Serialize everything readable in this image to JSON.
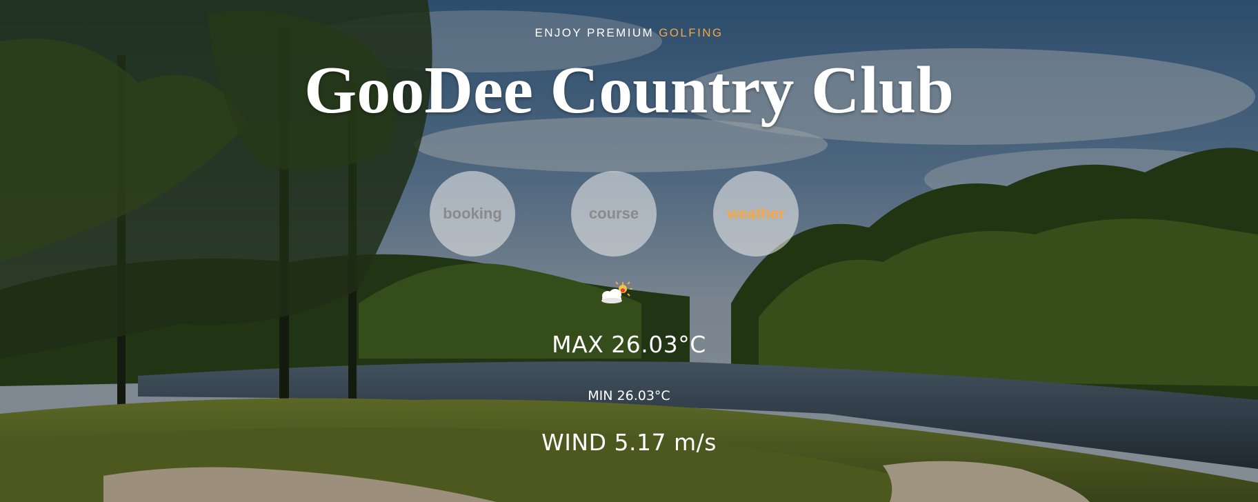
{
  "hero": {
    "tagline_prefix": "ENJOY PREMIUM",
    "tagline_accent": "GOLFING",
    "title": "GooDee Country Club"
  },
  "nav": {
    "items": [
      {
        "label": "booking",
        "active": false
      },
      {
        "label": "course",
        "active": false
      },
      {
        "label": "weather",
        "active": true
      }
    ]
  },
  "weather": {
    "icon": "cloud-sun-icon",
    "max": "MAX 26.03°C",
    "min": "MIN 26.03°C",
    "wind": "WIND 5.17 m/s"
  },
  "colors": {
    "accent": "#f5a742",
    "text": "#ffffff",
    "nav_text": "#8a8a8a"
  },
  "background": {
    "scene": "golf course with lake, pine trees and cloudy sky"
  }
}
